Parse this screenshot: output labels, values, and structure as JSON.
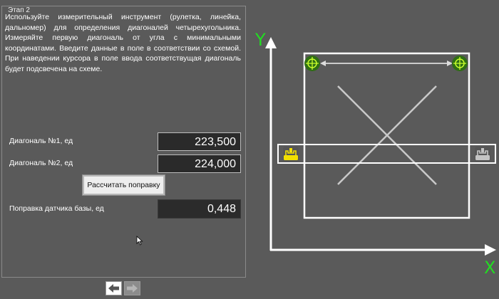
{
  "stage": {
    "title": "Этап 2",
    "instructions": "Используйте измерительный инструмент (рулетка, линейка, дальномер) для определения диагоналей четырехугольника. Измеряйте первую диагональ от угла с минимальными координатами. Введите данные в поле в соответствии со схемой. При наведении курсора в поле ввода соответствущая диагональ будет подсвечена на схеме."
  },
  "form": {
    "diag1_label": "Диагональ №1, ед",
    "diag1_value": "223,500",
    "diag2_label": "Диагональ №2, ед",
    "diag2_value": "224,000",
    "calc_button": "Рассчитать поправку",
    "correction_label": "Поправка датчика базы, ед",
    "correction_value": "0,448"
  },
  "diagram": {
    "y_axis_label": "Y",
    "x_axis_label": "X"
  },
  "nav": {
    "prev_icon": "arrow-left-icon",
    "next_icon": "arrow-right-icon"
  },
  "colors": {
    "axis_label": "#22dd22",
    "sensor_active": "#f2e000",
    "target_marker": "#3a7a1a"
  }
}
